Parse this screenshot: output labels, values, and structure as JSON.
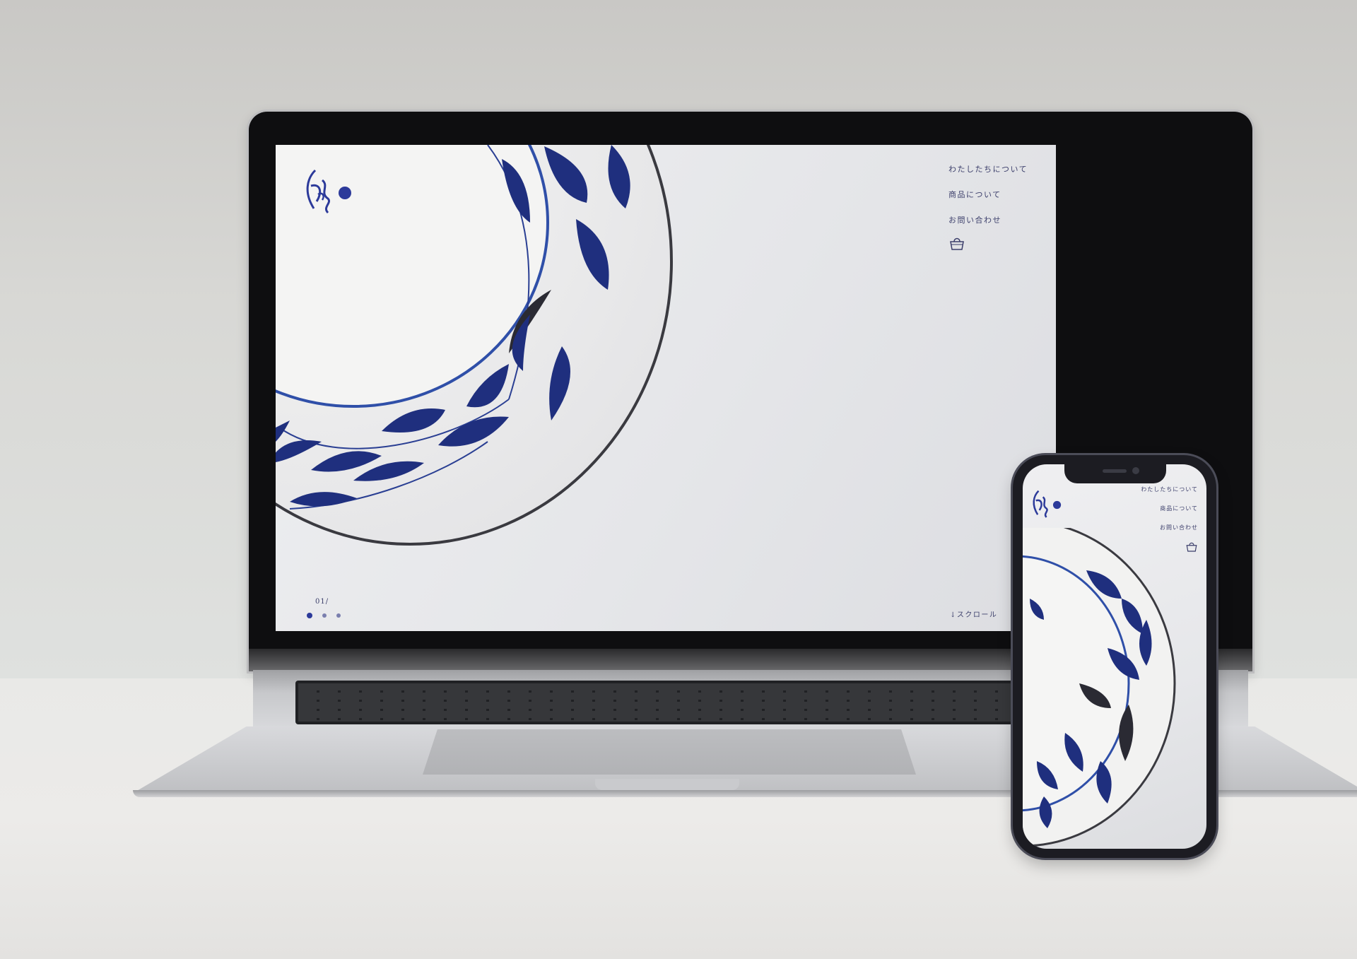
{
  "site": {
    "nav": {
      "about_label": "わたしたちについて",
      "products_label": "商品について",
      "contact_label": "お問い合わせ"
    },
    "slider": {
      "counter": "01/",
      "total_dots": 3,
      "active_index": 0
    },
    "scroll_label": "↓スクロール"
  },
  "colors": {
    "accent": "#2c3a9a",
    "text": "#3b3e6a",
    "screen_bg": "#e8e9ec"
  },
  "icons": [
    "logo-brush-icon",
    "cart-basket-icon"
  ]
}
